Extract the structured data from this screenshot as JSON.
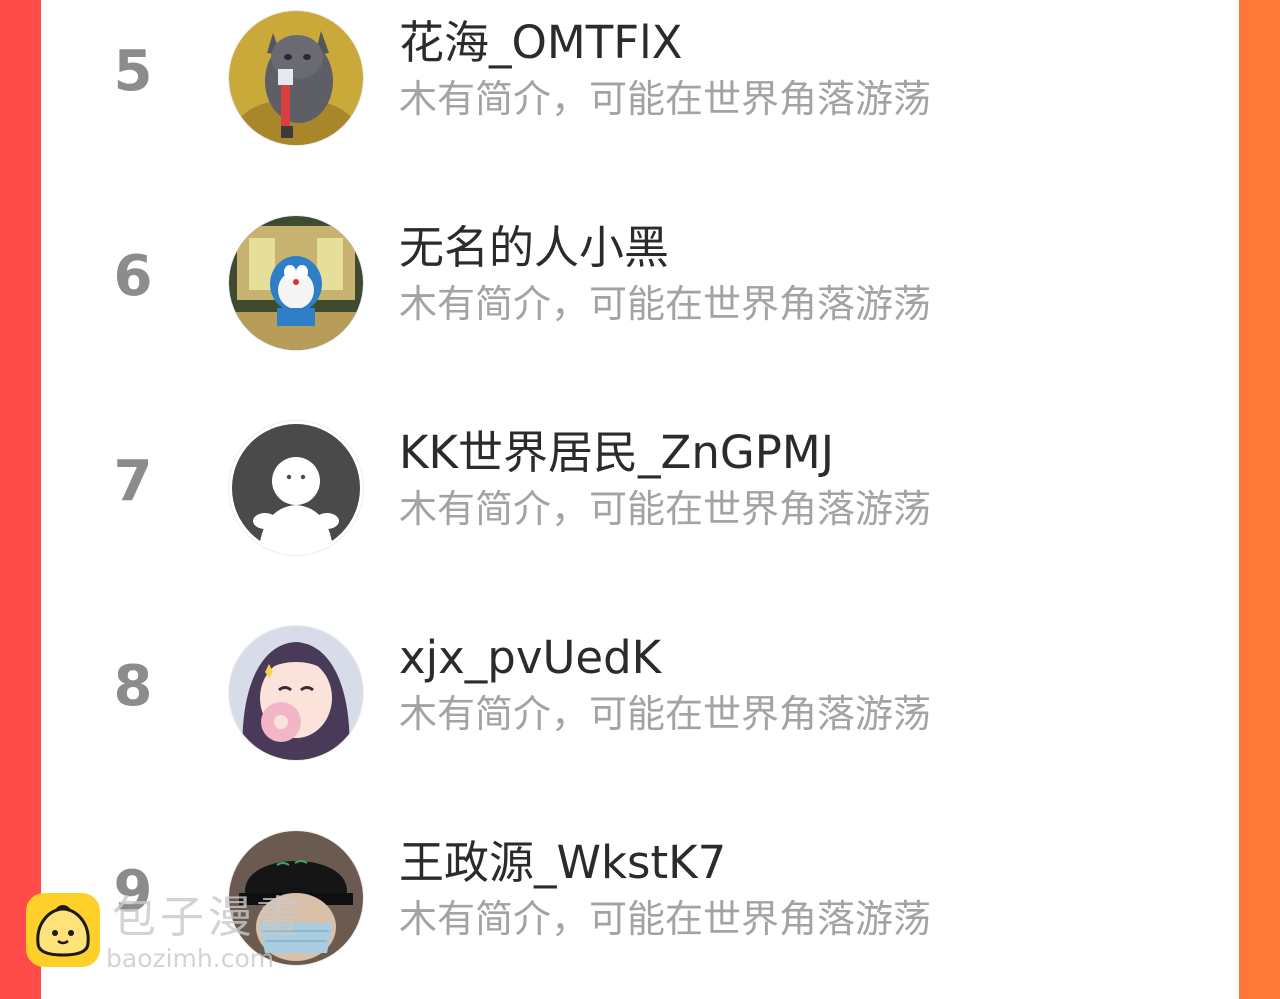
{
  "ranking": {
    "items": [
      {
        "rank": "5",
        "name": "花海_OMTFlX",
        "bio": "木有简介，可能在世界角落游荡",
        "avatar_icon": "cat-with-toy-avatar"
      },
      {
        "rank": "6",
        "name": "无名的人小黑",
        "bio": "木有简介，可能在世界角落游荡",
        "avatar_icon": "doraemon-avatar"
      },
      {
        "rank": "7",
        "name": "KK世界居民_ZnGPMJ",
        "bio": "木有简介，可能在世界角落游荡",
        "avatar_icon": "default-ghost-avatar"
      },
      {
        "rank": "8",
        "name": "xjx_pvUedK",
        "bio": "木有简介，可能在世界角落游荡",
        "avatar_icon": "anime-girl-avatar"
      },
      {
        "rank": "9",
        "name": "王政源_WkstK7",
        "bio": "木有简介，可能在世界角落游荡",
        "avatar_icon": "person-with-mask-avatar"
      }
    ]
  },
  "watermark": {
    "title": "包子漫畫",
    "url": "baozimh.com",
    "logo_icon": "bun-logo-icon"
  },
  "colors": {
    "background_left": "#ff4a4a",
    "background_right": "#ff7a38",
    "panel": "#ffffff",
    "rank_text": "#8c8c8c",
    "name_text": "#2b2b2b",
    "bio_text": "#a3a3a3"
  }
}
